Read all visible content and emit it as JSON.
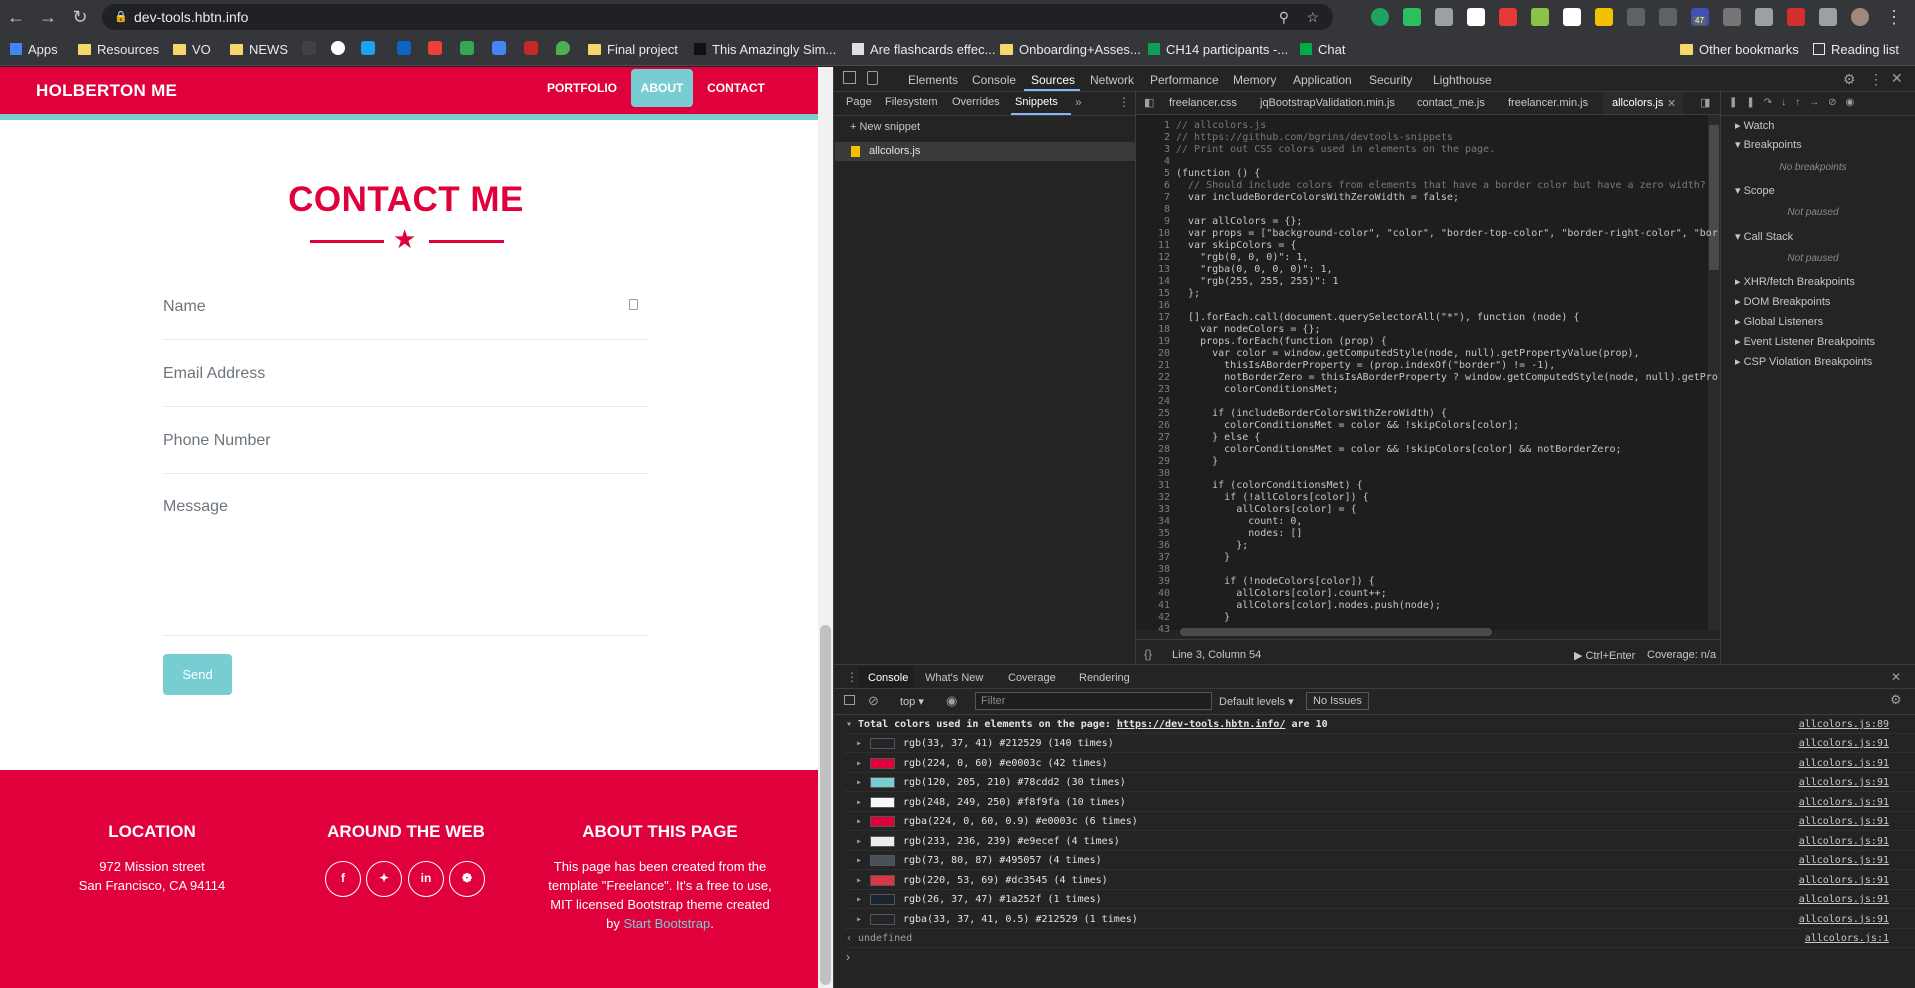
{
  "browser": {
    "url": "dev-tools.hbtn.info",
    "extension_badge": "47",
    "bookmarks": [
      "Apps",
      "Resources",
      "VO",
      "NEWS",
      "Final project",
      "This Amazingly Sim...",
      "Are flashcards effec...",
      "Onboarding+Asses...",
      "CH14 participants -...",
      "Chat"
    ],
    "bookmarks_right": [
      "Other bookmarks",
      "Reading list"
    ]
  },
  "site": {
    "brand": "HOLBERTON ME",
    "nav": [
      "PORTFOLIO",
      "ABOUT",
      "CONTACT"
    ],
    "contact_title": "CONTACT ME",
    "fields": {
      "name": "Name",
      "email": "Email Address",
      "phone": "Phone Number",
      "message": "Message"
    },
    "send": "Send",
    "footer": {
      "location_head": "LOCATION",
      "location_line1": "972 Mission street",
      "location_line2": "San Francisco, CA 94114",
      "web_head": "AROUND THE WEB",
      "about_head": "ABOUT THIS PAGE",
      "about_line1": "This page has been created from the",
      "about_line2": "template \"Freelance\". It's a free to use,",
      "about_line3": "MIT licensed Bootstrap theme created",
      "about_line4_pre": "by ",
      "about_link": "Start Bootstrap",
      "about_line4_post": "."
    },
    "colors": {
      "accent": "#e0003c",
      "teal": "#78cdd2"
    }
  },
  "devtools": {
    "tabs": [
      "Elements",
      "Console",
      "Sources",
      "Network",
      "Performance",
      "Memory",
      "Application",
      "Security",
      "Lighthouse"
    ],
    "nav_tabs": [
      "Page",
      "Filesystem",
      "Overrides",
      "Snippets"
    ],
    "new_snippet": "New snippet",
    "snippet_file": "allcolors.js",
    "file_tabs": [
      "freelancer.css",
      "jqBootstrapValidation.min.js",
      "contact_me.js",
      "freelancer.min.js",
      "allcolors.js"
    ],
    "status_pos": "Line 3, Column 54",
    "status_run": "Ctrl+Enter",
    "status_cov": "Coverage: n/a",
    "right_panel": {
      "watch": "Watch",
      "breakpoints": "Breakpoints",
      "no_breakpoints": "No breakpoints",
      "scope": "Scope",
      "not_paused_1": "Not paused",
      "call_stack": "Call Stack",
      "not_paused_2": "Not paused",
      "items": [
        "XHR/fetch Breakpoints",
        "DOM Breakpoints",
        "Global Listeners",
        "Event Listener Breakpoints",
        "CSP Violation Breakpoints"
      ]
    },
    "code_lines": [
      "// allcolors.js",
      "// https://github.com/bgrins/devtools-snippets",
      "// Print out CSS colors used in elements on the page.",
      "",
      "(function () {",
      "  // Should include colors from elements that have a border color but have a zero width?",
      "  var includeBorderColorsWithZeroWidth = false;",
      "",
      "  var allColors = {};",
      "  var props = [\"background-color\", \"color\", \"border-top-color\", \"border-right-color\", \"bor",
      "  var skipColors = {",
      "    \"rgb(0, 0, 0)\": 1,",
      "    \"rgba(0, 0, 0, 0)\": 1,",
      "    \"rgb(255, 255, 255)\": 1",
      "  };",
      "",
      "  [].forEach.call(document.querySelectorAll(\"*\"), function (node) {",
      "    var nodeColors = {};",
      "    props.forEach(function (prop) {",
      "      var color = window.getComputedStyle(node, null).getPropertyValue(prop),",
      "        thisIsABorderProperty = (prop.indexOf(\"border\") != -1),",
      "        notBorderZero = thisIsABorderProperty ? window.getComputedStyle(node, null).getPro",
      "        colorConditionsMet;",
      "",
      "      if (includeBorderColorsWithZeroWidth) {",
      "        colorConditionsMet = color && !skipColors[color];",
      "      } else {",
      "        colorConditionsMet = color && !skipColors[color] && notBorderZero;",
      "      }",
      "",
      "      if (colorConditionsMet) {",
      "        if (!allColors[color]) {",
      "          allColors[color] = {",
      "            count: 0,",
      "            nodes: []",
      "          };",
      "        }",
      "",
      "        if (!nodeColors[color]) {",
      "          allColors[color].count++;",
      "          allColors[color].nodes.push(node);",
      "        }",
      ""
    ],
    "drawer_tabs": [
      "Console",
      "What's New",
      "Coverage",
      "Rendering"
    ],
    "console_context": "top",
    "filter_placeholder": "Filter",
    "levels": "Default levels",
    "issues": "No Issues",
    "summary": "Total colors used in elements on the page: ",
    "summary_link": "https://dev-tools.hbtn.info/",
    "summary_tail": " are 10",
    "summary_src": "allcolors.js:89",
    "rows": [
      {
        "text": "rgb(33, 37, 41) #212529 (140 times)",
        "color": "#212529",
        "src": "allcolors.js:91"
      },
      {
        "text": "rgb(224, 0, 60) #e0003c (42 times)",
        "color": "#e0003c",
        "src": "allcolors.js:91"
      },
      {
        "text": "rgb(120, 205, 210) #78cdd2 (30 times)",
        "color": "#78cdd2",
        "src": "allcolors.js:91"
      },
      {
        "text": "rgb(248, 249, 250) #f8f9fa (10 times)",
        "color": "#f8f9fa",
        "src": "allcolors.js:91"
      },
      {
        "text": "rgba(224, 0, 60, 0.9) #e0003c (6 times)",
        "color": "#e0003c",
        "src": "allcolors.js:91"
      },
      {
        "text": "rgb(233, 236, 239) #e9ecef (4 times)",
        "color": "#e9ecef",
        "src": "allcolors.js:91"
      },
      {
        "text": "rgb(73, 80, 87) #495057 (4 times)",
        "color": "#495057",
        "src": "allcolors.js:91"
      },
      {
        "text": "rgb(220, 53, 69) #dc3545 (4 times)",
        "color": "#dc3545",
        "src": "allcolors.js:91"
      },
      {
        "text": "rgb(26, 37, 47) #1a252f (1 times)",
        "color": "#1a252f",
        "src": "allcolors.js:91"
      },
      {
        "text": "rgba(33, 37, 41, 0.5) #212529 (1 times)",
        "color": "#212529",
        "src": "allcolors.js:91"
      }
    ],
    "undefined_text": "undefined",
    "undefined_src": "allcolors.js:1"
  }
}
